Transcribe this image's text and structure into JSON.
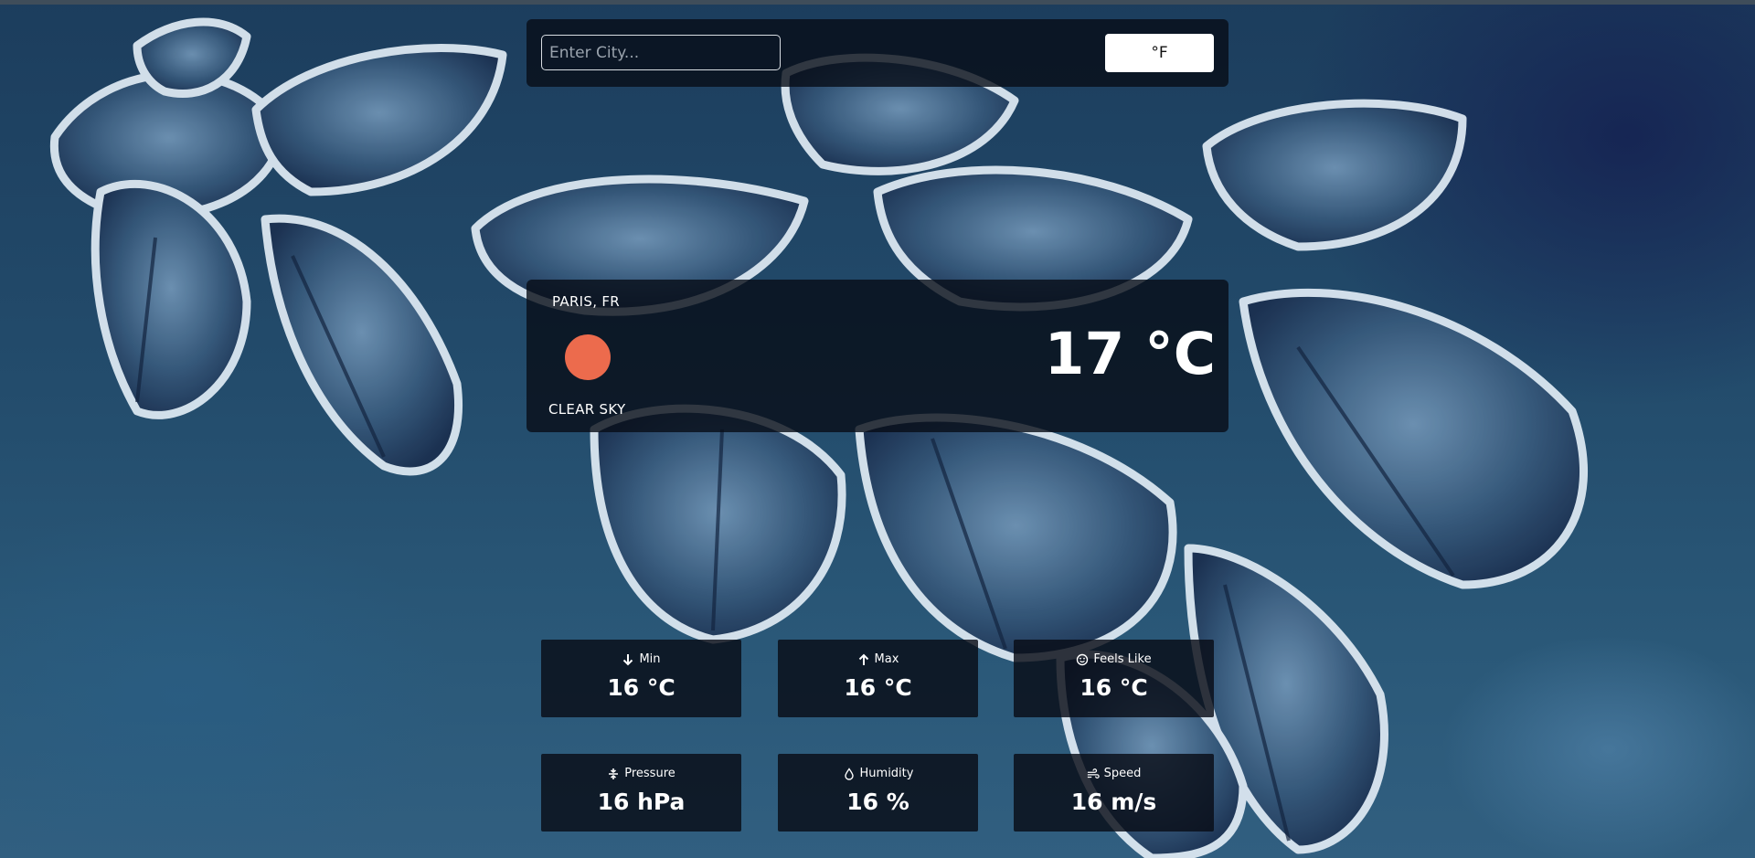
{
  "search": {
    "placeholder": "Enter City...",
    "value": ""
  },
  "unit_toggle": {
    "label": "°F"
  },
  "current": {
    "location": "PARIS, FR",
    "description": "CLEAR SKY",
    "temperature": "17 °C",
    "icon": "sun-icon",
    "icon_color": "#ec6b4d"
  },
  "stats": [
    {
      "label": "Min",
      "value": "16 °C",
      "icon": "arrow-down-icon"
    },
    {
      "label": "Max",
      "value": "16 °C",
      "icon": "arrow-up-icon"
    },
    {
      "label": "Feels Like",
      "value": "16 °C",
      "icon": "smile-icon"
    },
    {
      "label": "Pressure",
      "value": "16 hPa",
      "icon": "compress-icon"
    },
    {
      "label": "Humidity",
      "value": "16 %",
      "icon": "droplet-icon"
    },
    {
      "label": "Speed",
      "value": "16 m/s",
      "icon": "wind-icon"
    }
  ],
  "colors": {
    "panel_bg": "#080c16",
    "accent_sun": "#ec6b4d",
    "button_bg": "#ffffff"
  }
}
